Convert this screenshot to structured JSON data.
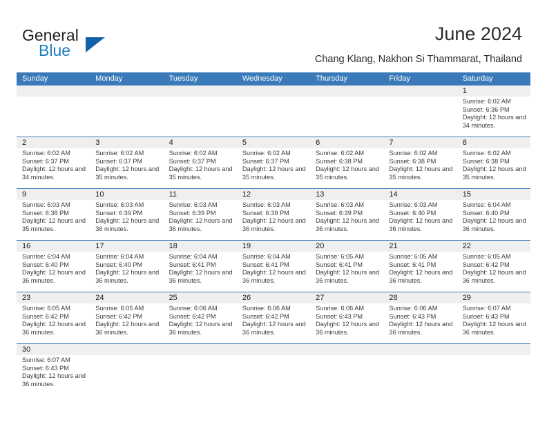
{
  "logo": {
    "primary_text": "General",
    "secondary_text": "Blue",
    "primary_color": "#231f20",
    "secondary_color": "#1c7cc0",
    "triangle_color": "#1360a8",
    "icon": "general-blue-logo"
  },
  "header": {
    "title": "June 2024",
    "subtitle": "Chang Klang, Nakhon Si Thammarat, Thailand"
  },
  "theme": {
    "header_band_color": "#3a7ab8",
    "day_band_color": "#efefef",
    "separator_color": "#3a7ab8",
    "text_color": "#3b3b3b"
  },
  "weekdays": [
    "Sunday",
    "Monday",
    "Tuesday",
    "Wednesday",
    "Thursday",
    "Friday",
    "Saturday"
  ],
  "weeks": [
    [
      {
        "day": "",
        "sunrise": "",
        "sunset": "",
        "daylight": "",
        "empty": true
      },
      {
        "day": "",
        "sunrise": "",
        "sunset": "",
        "daylight": "",
        "empty": true
      },
      {
        "day": "",
        "sunrise": "",
        "sunset": "",
        "daylight": "",
        "empty": true
      },
      {
        "day": "",
        "sunrise": "",
        "sunset": "",
        "daylight": "",
        "empty": true
      },
      {
        "day": "",
        "sunrise": "",
        "sunset": "",
        "daylight": "",
        "empty": true
      },
      {
        "day": "",
        "sunrise": "",
        "sunset": "",
        "daylight": "",
        "empty": true
      },
      {
        "day": "1",
        "sunrise": "Sunrise: 6:02 AM",
        "sunset": "Sunset: 6:36 PM",
        "daylight": "Daylight: 12 hours and 34 minutes.",
        "empty": false
      }
    ],
    [
      {
        "day": "2",
        "sunrise": "Sunrise: 6:02 AM",
        "sunset": "Sunset: 6:37 PM",
        "daylight": "Daylight: 12 hours and 34 minutes.",
        "empty": false
      },
      {
        "day": "3",
        "sunrise": "Sunrise: 6:02 AM",
        "sunset": "Sunset: 6:37 PM",
        "daylight": "Daylight: 12 hours and 35 minutes.",
        "empty": false
      },
      {
        "day": "4",
        "sunrise": "Sunrise: 6:02 AM",
        "sunset": "Sunset: 6:37 PM",
        "daylight": "Daylight: 12 hours and 35 minutes.",
        "empty": false
      },
      {
        "day": "5",
        "sunrise": "Sunrise: 6:02 AM",
        "sunset": "Sunset: 6:37 PM",
        "daylight": "Daylight: 12 hours and 35 minutes.",
        "empty": false
      },
      {
        "day": "6",
        "sunrise": "Sunrise: 6:02 AM",
        "sunset": "Sunset: 6:38 PM",
        "daylight": "Daylight: 12 hours and 35 minutes.",
        "empty": false
      },
      {
        "day": "7",
        "sunrise": "Sunrise: 6:02 AM",
        "sunset": "Sunset: 6:38 PM",
        "daylight": "Daylight: 12 hours and 35 minutes.",
        "empty": false
      },
      {
        "day": "8",
        "sunrise": "Sunrise: 6:02 AM",
        "sunset": "Sunset: 6:38 PM",
        "daylight": "Daylight: 12 hours and 35 minutes.",
        "empty": false
      }
    ],
    [
      {
        "day": "9",
        "sunrise": "Sunrise: 6:03 AM",
        "sunset": "Sunset: 6:38 PM",
        "daylight": "Daylight: 12 hours and 35 minutes.",
        "empty": false
      },
      {
        "day": "10",
        "sunrise": "Sunrise: 6:03 AM",
        "sunset": "Sunset: 6:39 PM",
        "daylight": "Daylight: 12 hours and 36 minutes.",
        "empty": false
      },
      {
        "day": "11",
        "sunrise": "Sunrise: 6:03 AM",
        "sunset": "Sunset: 6:39 PM",
        "daylight": "Daylight: 12 hours and 36 minutes.",
        "empty": false
      },
      {
        "day": "12",
        "sunrise": "Sunrise: 6:03 AM",
        "sunset": "Sunset: 6:39 PM",
        "daylight": "Daylight: 12 hours and 36 minutes.",
        "empty": false
      },
      {
        "day": "13",
        "sunrise": "Sunrise: 6:03 AM",
        "sunset": "Sunset: 6:39 PM",
        "daylight": "Daylight: 12 hours and 36 minutes.",
        "empty": false
      },
      {
        "day": "14",
        "sunrise": "Sunrise: 6:03 AM",
        "sunset": "Sunset: 6:40 PM",
        "daylight": "Daylight: 12 hours and 36 minutes.",
        "empty": false
      },
      {
        "day": "15",
        "sunrise": "Sunrise: 6:04 AM",
        "sunset": "Sunset: 6:40 PM",
        "daylight": "Daylight: 12 hours and 36 minutes.",
        "empty": false
      }
    ],
    [
      {
        "day": "16",
        "sunrise": "Sunrise: 6:04 AM",
        "sunset": "Sunset: 6:40 PM",
        "daylight": "Daylight: 12 hours and 36 minutes.",
        "empty": false
      },
      {
        "day": "17",
        "sunrise": "Sunrise: 6:04 AM",
        "sunset": "Sunset: 6:40 PM",
        "daylight": "Daylight: 12 hours and 36 minutes.",
        "empty": false
      },
      {
        "day": "18",
        "sunrise": "Sunrise: 6:04 AM",
        "sunset": "Sunset: 6:41 PM",
        "daylight": "Daylight: 12 hours and 36 minutes.",
        "empty": false
      },
      {
        "day": "19",
        "sunrise": "Sunrise: 6:04 AM",
        "sunset": "Sunset: 6:41 PM",
        "daylight": "Daylight: 12 hours and 36 minutes.",
        "empty": false
      },
      {
        "day": "20",
        "sunrise": "Sunrise: 6:05 AM",
        "sunset": "Sunset: 6:41 PM",
        "daylight": "Daylight: 12 hours and 36 minutes.",
        "empty": false
      },
      {
        "day": "21",
        "sunrise": "Sunrise: 6:05 AM",
        "sunset": "Sunset: 6:41 PM",
        "daylight": "Daylight: 12 hours and 36 minutes.",
        "empty": false
      },
      {
        "day": "22",
        "sunrise": "Sunrise: 6:05 AM",
        "sunset": "Sunset: 6:42 PM",
        "daylight": "Daylight: 12 hours and 36 minutes.",
        "empty": false
      }
    ],
    [
      {
        "day": "23",
        "sunrise": "Sunrise: 6:05 AM",
        "sunset": "Sunset: 6:42 PM",
        "daylight": "Daylight: 12 hours and 36 minutes.",
        "empty": false
      },
      {
        "day": "24",
        "sunrise": "Sunrise: 6:05 AM",
        "sunset": "Sunset: 6:42 PM",
        "daylight": "Daylight: 12 hours and 36 minutes.",
        "empty": false
      },
      {
        "day": "25",
        "sunrise": "Sunrise: 6:06 AM",
        "sunset": "Sunset: 6:42 PM",
        "daylight": "Daylight: 12 hours and 36 minutes.",
        "empty": false
      },
      {
        "day": "26",
        "sunrise": "Sunrise: 6:06 AM",
        "sunset": "Sunset: 6:42 PM",
        "daylight": "Daylight: 12 hours and 36 minutes.",
        "empty": false
      },
      {
        "day": "27",
        "sunrise": "Sunrise: 6:06 AM",
        "sunset": "Sunset: 6:43 PM",
        "daylight": "Daylight: 12 hours and 36 minutes.",
        "empty": false
      },
      {
        "day": "28",
        "sunrise": "Sunrise: 6:06 AM",
        "sunset": "Sunset: 6:43 PM",
        "daylight": "Daylight: 12 hours and 36 minutes.",
        "empty": false
      },
      {
        "day": "29",
        "sunrise": "Sunrise: 6:07 AM",
        "sunset": "Sunset: 6:43 PM",
        "daylight": "Daylight: 12 hours and 36 minutes.",
        "empty": false
      }
    ],
    [
      {
        "day": "30",
        "sunrise": "Sunrise: 6:07 AM",
        "sunset": "Sunset: 6:43 PM",
        "daylight": "Daylight: 12 hours and 36 minutes.",
        "empty": false
      },
      {
        "day": "",
        "sunrise": "",
        "sunset": "",
        "daylight": "",
        "empty": true
      },
      {
        "day": "",
        "sunrise": "",
        "sunset": "",
        "daylight": "",
        "empty": true
      },
      {
        "day": "",
        "sunrise": "",
        "sunset": "",
        "daylight": "",
        "empty": true
      },
      {
        "day": "",
        "sunrise": "",
        "sunset": "",
        "daylight": "",
        "empty": true
      },
      {
        "day": "",
        "sunrise": "",
        "sunset": "",
        "daylight": "",
        "empty": true
      },
      {
        "day": "",
        "sunrise": "",
        "sunset": "",
        "daylight": "",
        "empty": true
      }
    ]
  ]
}
